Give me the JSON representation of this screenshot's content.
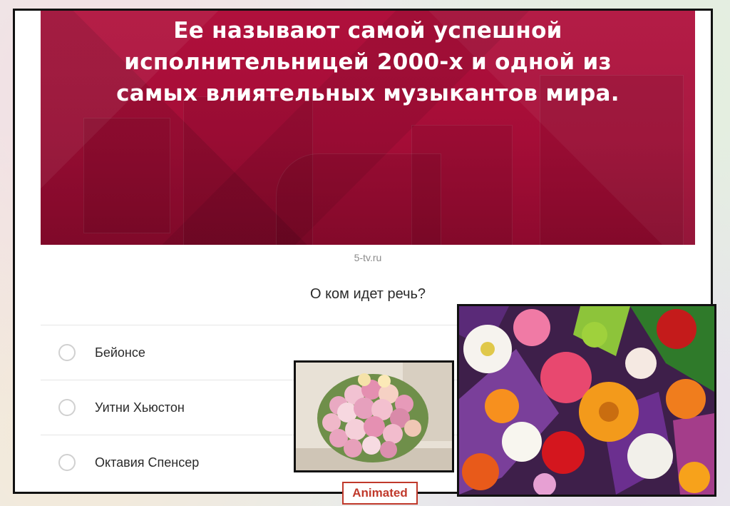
{
  "banner": {
    "lines": [
      "Ее называют самой успешной",
      "исполнительницей 2000-х и одной из",
      "самых влиятельных музыкантов мира."
    ]
  },
  "source_caption": "5-tv.ru",
  "question": "О ком идет речь?",
  "options": [
    {
      "label": "Бейонсе"
    },
    {
      "label": "Уитни Хьюстон"
    },
    {
      "label": "Октавия Спенсер"
    }
  ],
  "badge": {
    "text": "Animated",
    "color": "#c0392b"
  },
  "colors": {
    "banner": "#a50d37",
    "frame_border": "#111111"
  },
  "images": {
    "small": "rose-bouquet-photo",
    "large": "colorful-flowers-photo"
  }
}
